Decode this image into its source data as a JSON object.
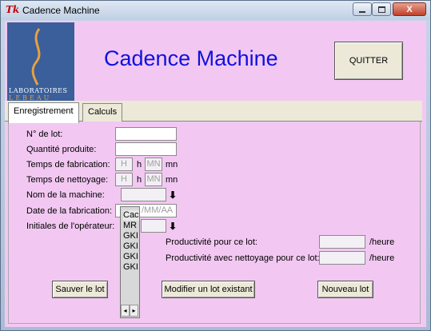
{
  "window": {
    "title": "Cadence Machine",
    "icon": "tk-feather-icon",
    "close_label": "X"
  },
  "logo": {
    "line1": "LABORATOIRES",
    "line2": "LEBEAU"
  },
  "app_title": "Cadence Machine",
  "quit_label": "QUITTER",
  "tabs": [
    {
      "label": "Enregistrement",
      "active": true
    },
    {
      "label": "Calculs",
      "active": false
    }
  ],
  "form": {
    "lot_label": "N° de lot:",
    "lot_value": "",
    "quantity_label": "Quantité produite:",
    "quantity_value": "",
    "fab_time_label": "Temps de fabrication:",
    "clean_time_label": "Temps de nettoyage:",
    "hour_placeholder": "H",
    "minute_placeholder": "MN",
    "h_unit": "h",
    "mn_unit": "mn",
    "machine_label": "Nom de la machine:",
    "machine_value": "",
    "date_label": "Date de la fabrication:",
    "date_placeholder": "/MM/AA",
    "operator_label": "Initiales de l'opérateur:",
    "operator_value": "",
    "dropdown_arrow": "⬇",
    "productivity_label": "Productivité pour ce lot:",
    "productivity_value": "",
    "productivity_clean_label": "Productivité avec nettoyage pour ce lot:",
    "productivity_clean_value": "",
    "per_hour": "/heure"
  },
  "dropdown_items": [
    "Cac",
    "MR",
    "GKI",
    "GKI",
    "GKI",
    "GKI"
  ],
  "buttons": {
    "save": "Sauver le lot",
    "modify": "Modifier un lot existant",
    "new": "Nouveau lot"
  },
  "colors": {
    "background": "#f2c8f2",
    "title": "#1010e0"
  }
}
